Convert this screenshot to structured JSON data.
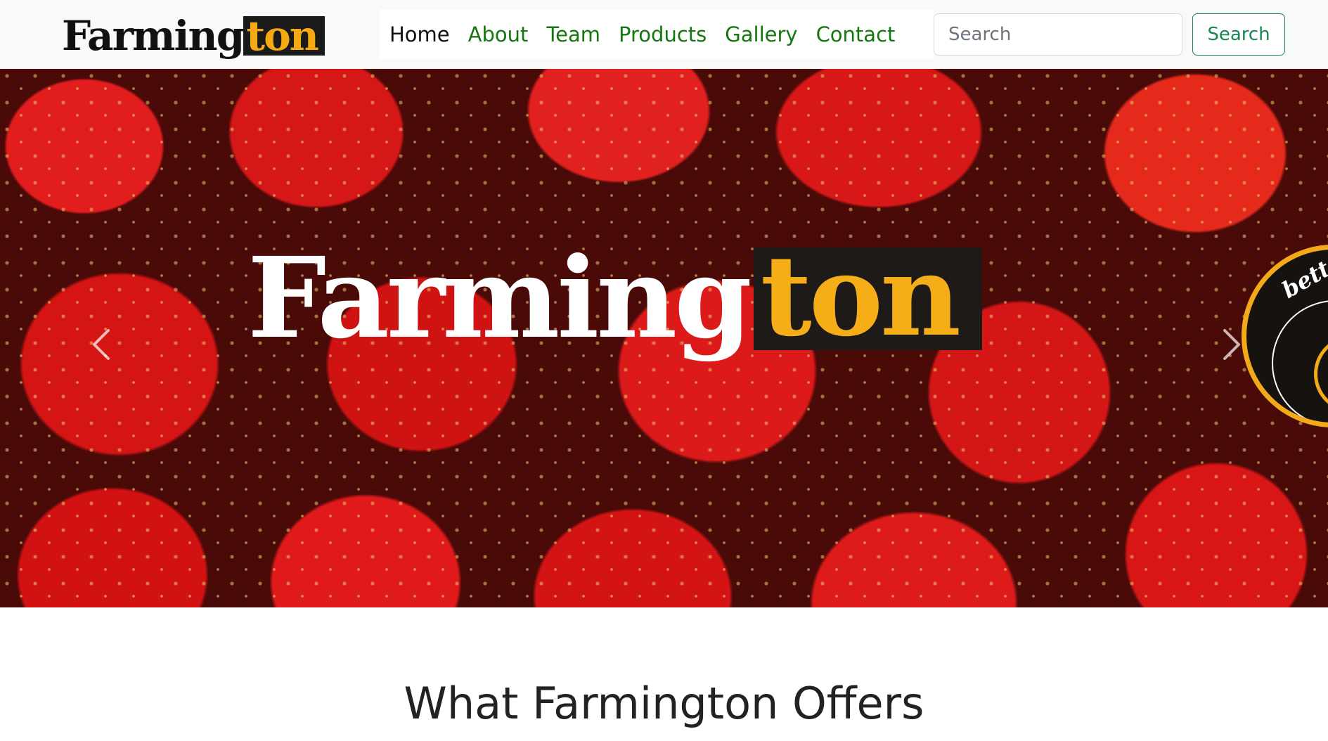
{
  "brand": {
    "part1": "Farming",
    "part2": "ton"
  },
  "nav": {
    "items": [
      {
        "label": "Home",
        "active": true
      },
      {
        "label": "About"
      },
      {
        "label": "Team"
      },
      {
        "label": "Products"
      },
      {
        "label": "Gallery"
      },
      {
        "label": "Contact"
      }
    ]
  },
  "search": {
    "placeholder": "Search",
    "button_label": "Search"
  },
  "hero": {
    "logo_part1": "Farming",
    "logo_part2": "ton",
    "badge_text": "bette"
  },
  "section": {
    "title": "What Farmington Offers"
  },
  "colors": {
    "accent": "#198754",
    "nav_link": "#15780f",
    "brand_gold": "#f5a913",
    "brand_dark": "#1a1a1a",
    "berry_red": "#d81616"
  },
  "icons": {
    "prev": "chevron-left-icon",
    "next": "chevron-right-icon"
  }
}
